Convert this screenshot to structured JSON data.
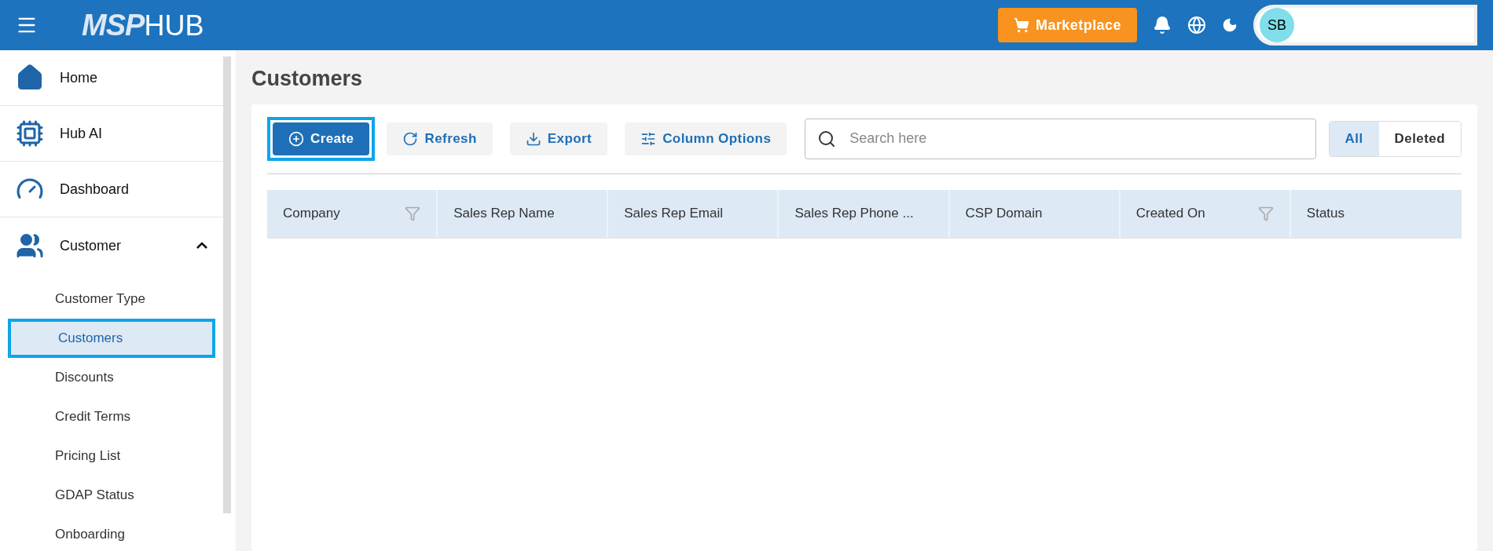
{
  "topbar": {
    "logo": {
      "bold": "MSP",
      "light": "HUB"
    },
    "marketplace": "Marketplace",
    "avatar": "SB"
  },
  "sidebar": {
    "items": [
      {
        "label": "Home"
      },
      {
        "label": "Hub AI"
      },
      {
        "label": "Dashboard"
      },
      {
        "label": "Customer",
        "expanded": true,
        "children": [
          {
            "label": "Customer Type",
            "selected": false
          },
          {
            "label": "Customers",
            "selected": true
          },
          {
            "label": "Discounts",
            "selected": false
          },
          {
            "label": "Credit Terms",
            "selected": false
          },
          {
            "label": "Pricing List",
            "selected": false
          },
          {
            "label": "GDAP Status",
            "selected": false
          },
          {
            "label": "Onboarding",
            "selected": false
          }
        ]
      }
    ]
  },
  "page": {
    "title": "Customers"
  },
  "toolbar": {
    "buttons": [
      {
        "label": "Create",
        "kind": "primary",
        "focused": true
      },
      {
        "label": "Refresh",
        "kind": "secondary",
        "focused": false
      },
      {
        "label": "Export",
        "kind": "secondary",
        "focused": false
      },
      {
        "label": "Column Options",
        "kind": "secondary",
        "focused": false
      }
    ],
    "search": {
      "placeholder": "Search here"
    },
    "filters": [
      {
        "label": "All",
        "selected": true
      },
      {
        "label": "Deleted",
        "selected": false
      }
    ]
  },
  "table": {
    "columns": [
      {
        "label": "Company",
        "filterable": true
      },
      {
        "label": "Sales Rep Name",
        "filterable": false
      },
      {
        "label": "Sales Rep Email",
        "filterable": false
      },
      {
        "label": "Sales Rep Phone ...",
        "filterable": false
      },
      {
        "label": "CSP Domain",
        "filterable": false
      },
      {
        "label": "Created On",
        "filterable": true
      },
      {
        "label": "Status",
        "filterable": false
      }
    ]
  }
}
